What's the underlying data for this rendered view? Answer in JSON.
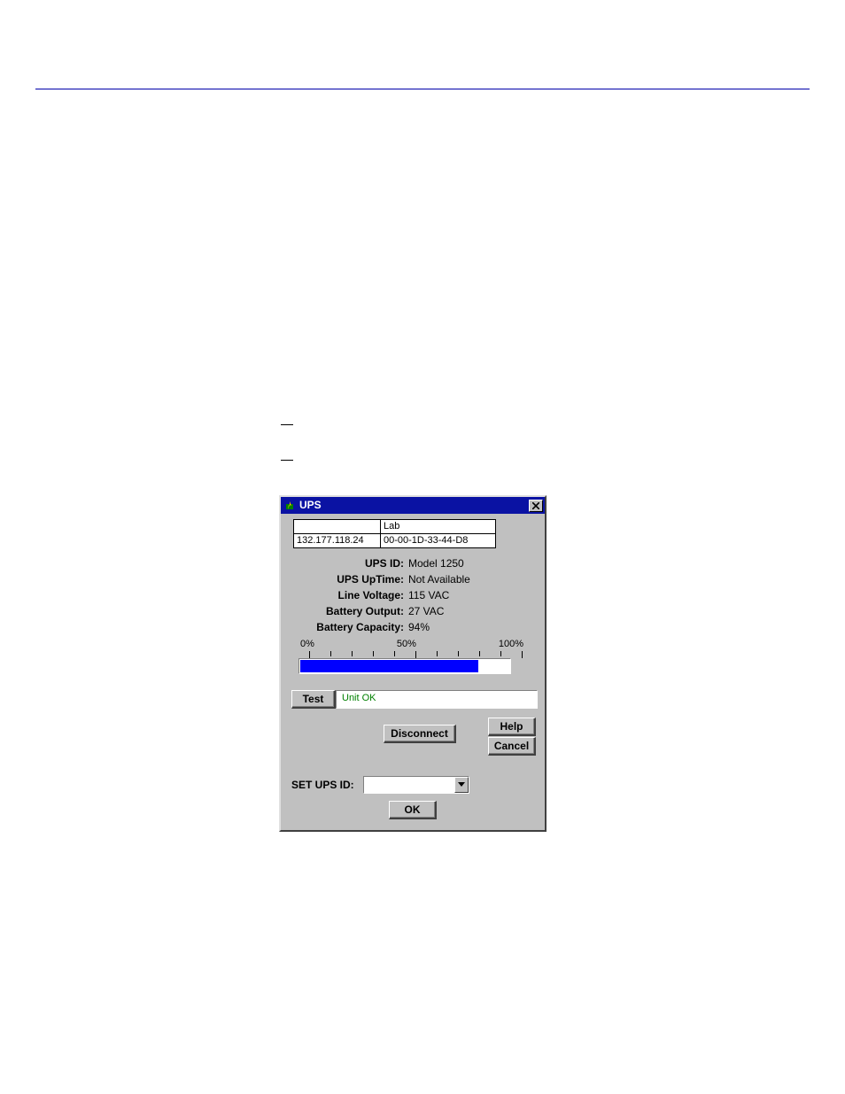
{
  "window": {
    "title": "UPS"
  },
  "address": {
    "r1c1": "",
    "r1c2": "Lab",
    "ip": "132.177.118.24",
    "mac": "00-00-1D-33-44-D8"
  },
  "labels": {
    "ups_id": "UPS ID:",
    "uptime": "UPS UpTime:",
    "line_voltage": "Line Voltage:",
    "battery_output": "Battery Output:",
    "battery_capacity": "Battery Capacity:",
    "set_ups_id": "SET UPS ID:"
  },
  "values": {
    "ups_id": "Model 1250",
    "uptime": "Not Available",
    "line_voltage": "115 VAC",
    "battery_output": "27 VAC",
    "battery_capacity": "94%"
  },
  "scale": {
    "low": "0%",
    "mid": "50%",
    "high": "100%"
  },
  "progress": {
    "percent": 85
  },
  "buttons": {
    "test": "Test",
    "disconnect": "Disconnect",
    "help": "Help",
    "cancel": "Cancel",
    "ok": "OK"
  },
  "test_status": "Unit OK",
  "set_ups_id_value": ""
}
